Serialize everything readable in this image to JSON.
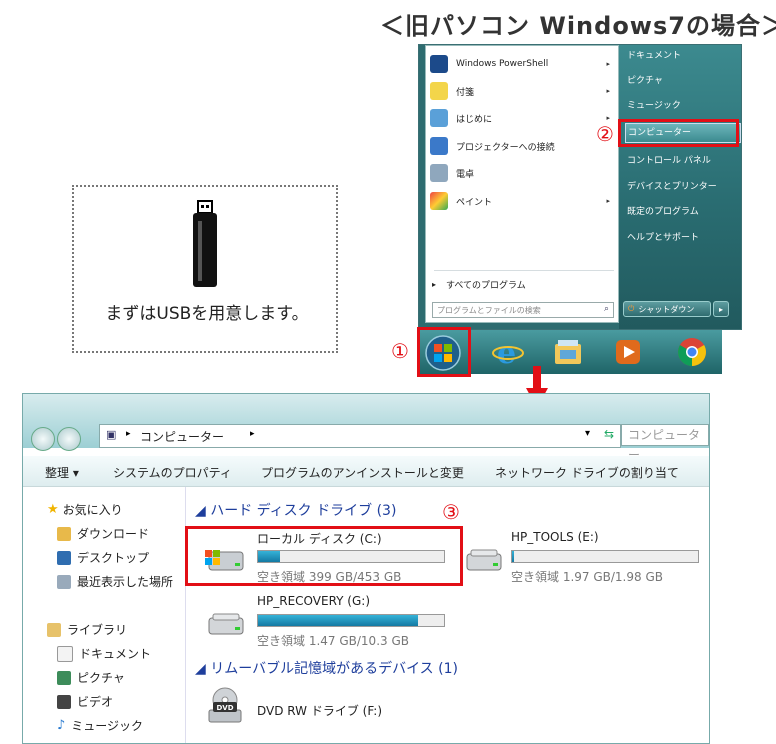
{
  "heading": "＜旧パソコン Windows7の場合＞",
  "usb_card": {
    "caption": "まずはUSBを用意します。"
  },
  "markers": {
    "one": "①",
    "two": "②",
    "three": "③"
  },
  "start_menu": {
    "left_items": [
      {
        "label": "Windows PowerShell",
        "icon": "powershell-icon",
        "has_arrow": true
      },
      {
        "label": "付箋",
        "icon": "sticky-notes-icon",
        "has_arrow": true
      },
      {
        "label": "はじめに",
        "icon": "getting-started-icon",
        "has_arrow": true
      },
      {
        "label": "プロジェクターへの接続",
        "icon": "projector-icon",
        "has_arrow": false
      },
      {
        "label": "電卓",
        "icon": "calculator-icon",
        "has_arrow": false
      },
      {
        "label": "ペイント",
        "icon": "paint-icon",
        "has_arrow": true
      }
    ],
    "all_programs": "すべてのプログラム",
    "search_placeholder": "プログラムとファイルの検索",
    "right_items": [
      "ドキュメント",
      "ピクチャ",
      "ミュージック",
      "コンピューター",
      "コントロール パネル",
      "デバイスとプリンター",
      "既定のプログラム",
      "ヘルプとサポート"
    ],
    "shutdown": "シャットダウン",
    "arrow_glyph": "▸"
  },
  "taskbar": {
    "icons": [
      "start-orb-icon",
      "internet-explorer-icon",
      "explorer-folder-icon",
      "media-player-icon",
      "chrome-icon"
    ]
  },
  "explorer": {
    "address": "コンピューター",
    "breadcrumb_arrow": "▸",
    "search_placeholder": "コンピューター",
    "toolbar": [
      "整理 ▾",
      "システムのプロパティ",
      "プログラムのアンインストールと変更",
      "ネットワーク ドライブの割り当て"
    ],
    "nav": {
      "favorites": "お気に入り",
      "downloads": "ダウンロード",
      "desktop": "デスクトップ",
      "recent": "最近表示した場所",
      "libraries": "ライブラリ",
      "documents": "ドキュメント",
      "pictures": "ピクチャ",
      "videos": "ビデオ",
      "music": "ミュージック"
    },
    "hdd_section": "◢ ハード ディスク ドライブ (3)",
    "removable_section": "◢ リムーバブル記憶域があるデバイス (1)",
    "drives": [
      {
        "name": "ローカル ディスク (C:)",
        "space": "空き領域 399 GB/453 GB",
        "used_fraction": 0.12
      },
      {
        "name": "HP_TOOLS (E:)",
        "space": "空き領域 1.97 GB/1.98 GB",
        "used_fraction": 0.01
      },
      {
        "name": "HP_RECOVERY (G:)",
        "space": "空き領域 1.47 GB/10.3 GB",
        "used_fraction": 0.86
      }
    ],
    "dvd": {
      "name": "DVD RW ドライブ (F:)",
      "label": "DVD"
    }
  },
  "colors": {
    "accent_red": "#e20f16",
    "bar_blue": "#1f8dbb",
    "taskbar": "#2c7b80"
  }
}
